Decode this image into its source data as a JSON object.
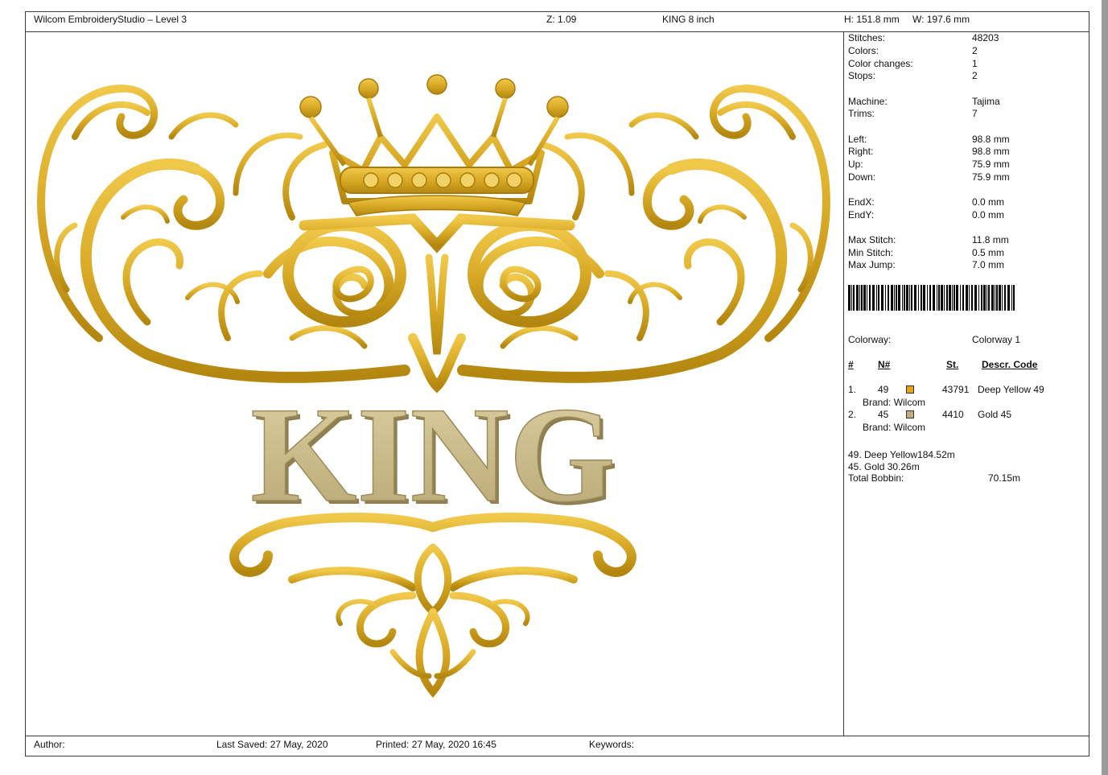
{
  "header": {
    "app_title": "Wilcom EmbroideryStudio – Level 3",
    "zoom": "Z: 1.09",
    "design_name": "KING 8 inch",
    "height": "H: 151.8 mm",
    "width": "W: 197.6 mm"
  },
  "design": {
    "title_text": "KING"
  },
  "stats": [
    {
      "label": "Stitches:",
      "value": "48203"
    },
    {
      "label": "Colors:",
      "value": "2"
    },
    {
      "label": "Color changes:",
      "value": "1"
    },
    {
      "label": "Stops:",
      "value": "2"
    },
    {
      "label": "Machine:",
      "value": "Tajima"
    },
    {
      "label": "Trims:",
      "value": "7"
    },
    {
      "label": "Left:",
      "value": "98.8 mm"
    },
    {
      "label": "Right:",
      "value": "98.8 mm"
    },
    {
      "label": "Up:",
      "value": "75.9 mm"
    },
    {
      "label": "Down:",
      "value": "75.9 mm"
    },
    {
      "label": "EndX:",
      "value": "0.0 mm"
    },
    {
      "label": "EndY:",
      "value": "0.0 mm"
    },
    {
      "label": "Max Stitch:",
      "value": "11.8 mm"
    },
    {
      "label": "Min Stitch:",
      "value": "0.5 mm"
    },
    {
      "label": "Max Jump:",
      "value": "7.0 mm"
    }
  ],
  "colorway": {
    "label": "Colorway:",
    "value": "Colorway 1"
  },
  "table": {
    "headers": {
      "num": "#",
      "n": "N#",
      "st": "St.",
      "descr": "Descr. Code"
    },
    "threads": [
      {
        "num": "1.",
        "n": "49",
        "color": "#e8a21a",
        "st": "43791",
        "descr": "Deep Yellow 49",
        "brand": "Brand: Wilcom"
      },
      {
        "num": "2.",
        "n": "45",
        "color": "#c2ab7c",
        "st": "4410",
        "descr": "Gold 45",
        "brand": "Brand: Wilcom"
      }
    ]
  },
  "usage": {
    "line1": "49. Deep Yellow184.52m",
    "line2": "45. Gold 30.26m",
    "bobbin_label": "Total Bobbin:",
    "bobbin_value": "70.15m"
  },
  "footer": {
    "author": "Author:",
    "last_saved": "Last Saved: 27 May, 2020",
    "printed": "Printed: 27 May, 2020 16:45",
    "keywords": "Keywords:"
  },
  "colors": {
    "gold": "#d9aa26",
    "gold_dark": "#b3860f",
    "khaki": "#c8b784",
    "khaki_dark": "#9c8c5c"
  }
}
